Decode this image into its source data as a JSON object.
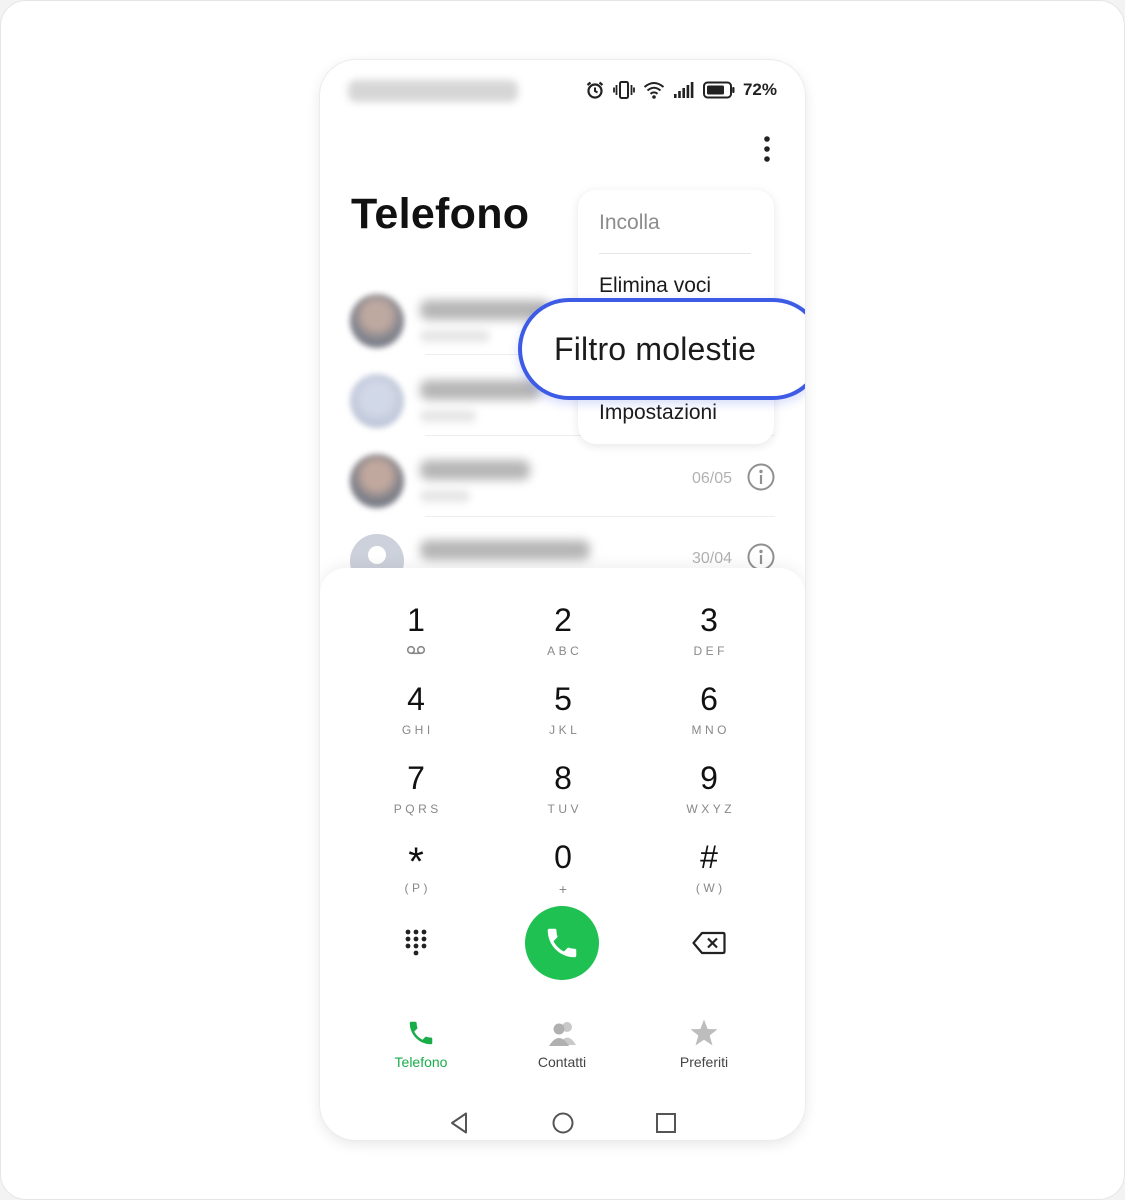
{
  "status_bar": {
    "battery_percent": "72%",
    "icons": [
      "alarm-icon",
      "vibrate-icon",
      "wifi-icon",
      "signal-icon",
      "battery-icon"
    ]
  },
  "header": {
    "title": "Telefono",
    "more_icon": "more-vertical-icon"
  },
  "menu": {
    "items": [
      {
        "label": "Incolla",
        "enabled": false
      },
      {
        "label": "Elimina voci",
        "enabled": true
      },
      {
        "label": "Filtro molestie",
        "enabled": true,
        "highlighted": true
      },
      {
        "label": "Impostazioni",
        "enabled": true
      }
    ]
  },
  "call_log": [
    {
      "date": ""
    },
    {
      "date": ""
    },
    {
      "date": "06/05"
    },
    {
      "date": "30/04"
    }
  ],
  "keypad": [
    {
      "digit": "1",
      "letters": "ᦶ"
    },
    {
      "digit": "2",
      "letters": "ABC"
    },
    {
      "digit": "3",
      "letters": "DEF"
    },
    {
      "digit": "4",
      "letters": "GHI"
    },
    {
      "digit": "5",
      "letters": "JKL"
    },
    {
      "digit": "6",
      "letters": "MNO"
    },
    {
      "digit": "7",
      "letters": "PQRS"
    },
    {
      "digit": "8",
      "letters": "TUV"
    },
    {
      "digit": "9",
      "letters": "WXYZ"
    },
    {
      "digit": "*",
      "letters": "(P)"
    },
    {
      "digit": "0",
      "letters": "+"
    },
    {
      "digit": "#",
      "letters": "(W)"
    }
  ],
  "bottom_tabs": [
    {
      "label": "Telefono",
      "icon": "phone-icon",
      "active": true
    },
    {
      "label": "Contatti",
      "icon": "contacts-icon",
      "active": false
    },
    {
      "label": "Preferiti",
      "icon": "star-icon",
      "active": false
    }
  ],
  "colors": {
    "accent_green": "#20c153",
    "highlight_blue": "#3d5be5"
  }
}
